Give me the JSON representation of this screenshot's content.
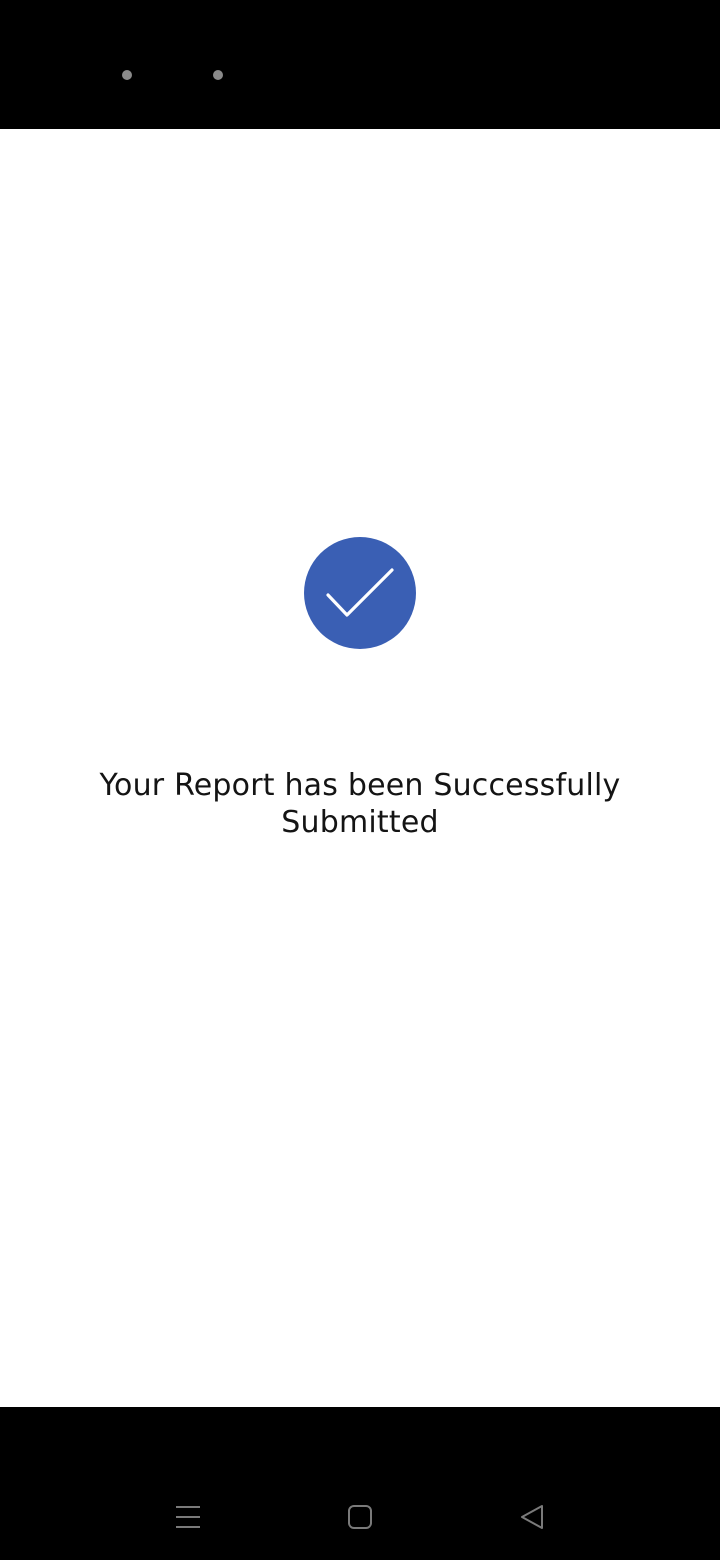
{
  "status_bar": {
    "icons": [
      "dot-icon",
      "dot-icon"
    ]
  },
  "main": {
    "icon": "check-circle-icon",
    "accent_color": "#3a5fb4",
    "message": "Your Report has been Successfully Submitted"
  },
  "navigation_bar": {
    "buttons": [
      {
        "icon": "menu-icon"
      },
      {
        "icon": "home-square-icon"
      },
      {
        "icon": "back-triangle-icon"
      }
    ]
  }
}
